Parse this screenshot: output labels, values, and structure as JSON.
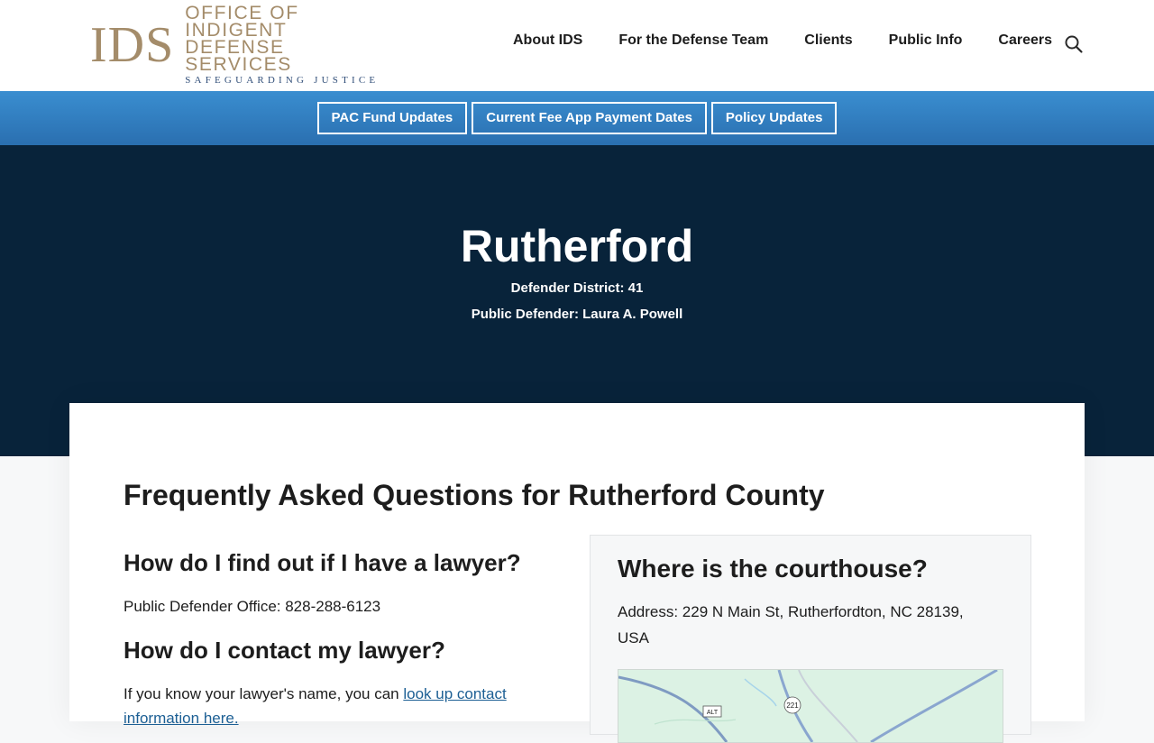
{
  "logo": {
    "mark": "IDS",
    "line1": "OFFICE OF INDIGENT",
    "line2": "DEFENSE SERVICES",
    "line3": "SAFEGUARDING JUSTICE"
  },
  "nav": {
    "items": [
      {
        "label": "About IDS"
      },
      {
        "label": "For the Defense Team"
      },
      {
        "label": "Clients"
      },
      {
        "label": "Public Info"
      },
      {
        "label": "Careers"
      }
    ]
  },
  "alert_bar": {
    "buttons": [
      {
        "label": "PAC Fund Updates"
      },
      {
        "label": "Current Fee App Payment Dates"
      },
      {
        "label": "Policy Updates"
      }
    ]
  },
  "hero": {
    "title": "Rutherford",
    "district": "Defender District: 41",
    "public_defender": "Public Defender: Laura A. Powell"
  },
  "faq": {
    "title": "Frequently Asked Questions for Rutherford County",
    "q1": {
      "heading": "How do I find out if I have a lawyer?",
      "text": "Public Defender Office: 828-288-6123"
    },
    "q2": {
      "heading": "How do I contact my lawyer?",
      "text_prefix": "If you know your lawyer's name, you can ",
      "link": "look up contact information here."
    },
    "courthouse": {
      "heading": "Where is the courthouse?",
      "address": "Address: 229 N Main St, Rutherfordton, NC 28139, USA"
    }
  },
  "map": {
    "shields": [
      "ALT",
      "221"
    ]
  },
  "colors": {
    "gold": "#a48c6a",
    "navy": "#08233a",
    "blue_bar": "#2f7fc2",
    "link": "#1c5f94"
  }
}
